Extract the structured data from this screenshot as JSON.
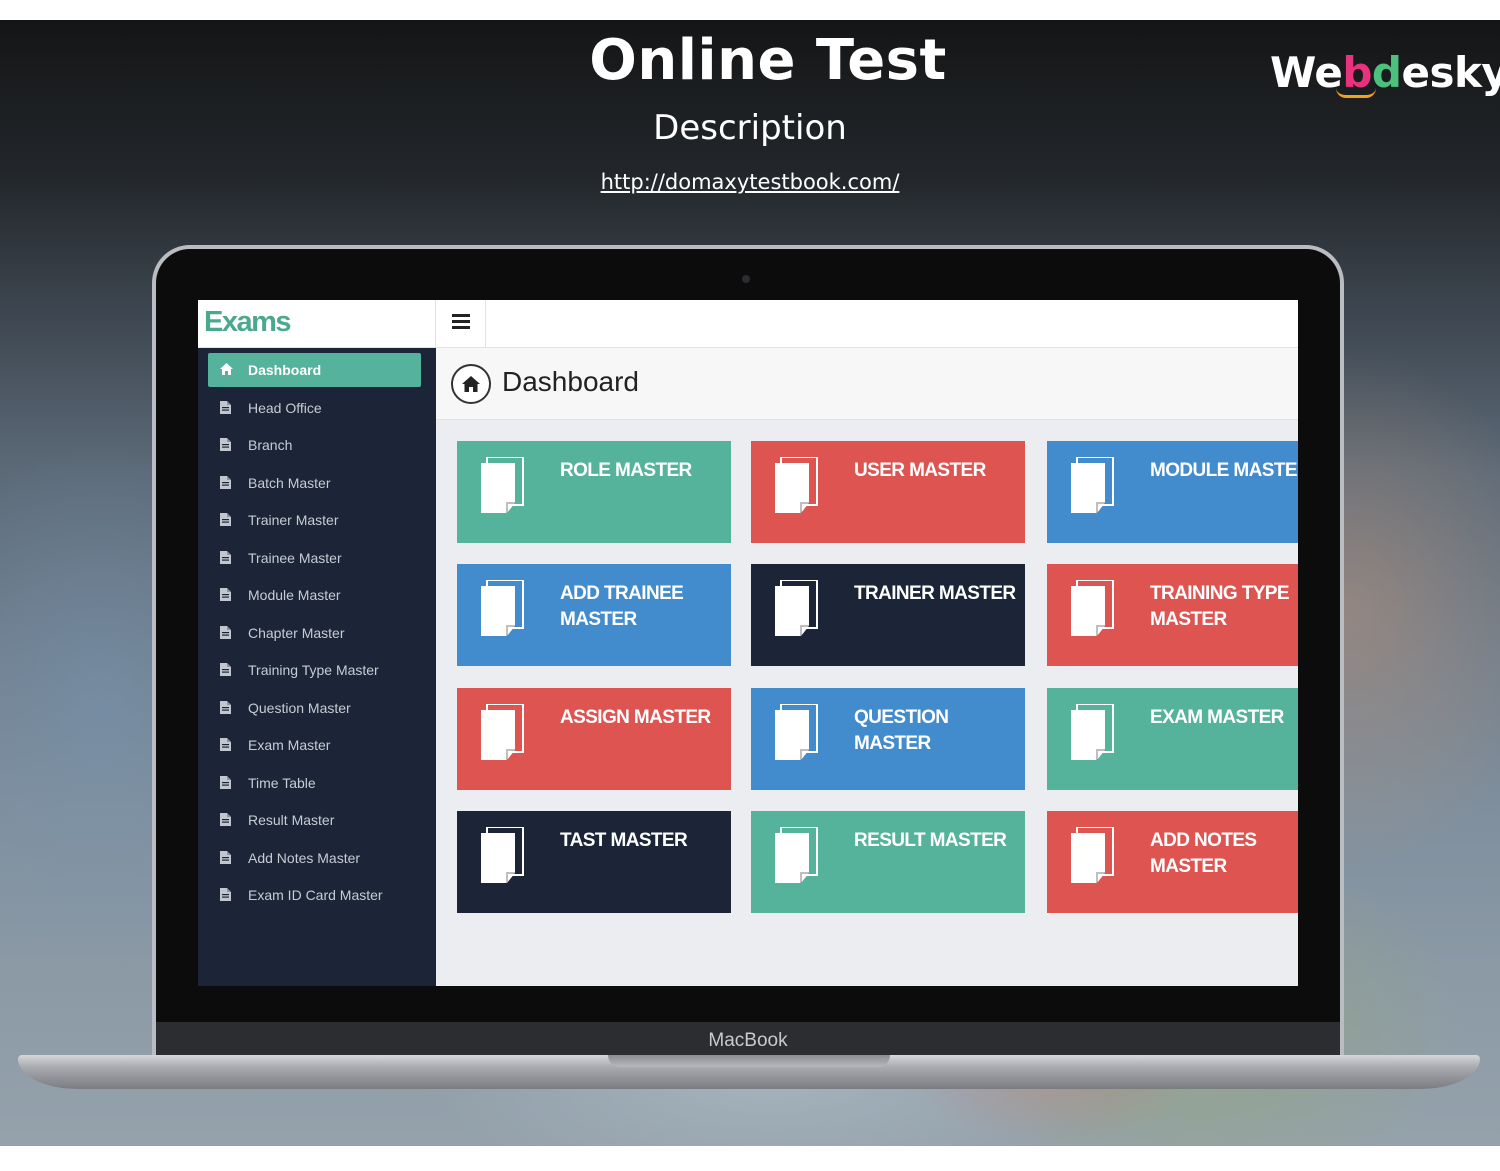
{
  "slide": {
    "title": "Online Test",
    "subtitle": "Description",
    "url": "http://domaxytestbook.com/",
    "brand": {
      "part1": "We",
      "part2": "b",
      "part3": "d",
      "part4": "esky"
    },
    "device_label": "MacBook"
  },
  "app": {
    "logo": "Exams",
    "page_title": "Dashboard",
    "sidebar": [
      {
        "label": "Dashboard",
        "icon": "home-icon",
        "active": true
      },
      {
        "label": "Head Office",
        "icon": "file-icon"
      },
      {
        "label": "Branch",
        "icon": "file-icon"
      },
      {
        "label": "Batch Master",
        "icon": "file-icon"
      },
      {
        "label": "Trainer Master",
        "icon": "file-icon"
      },
      {
        "label": "Trainee Master",
        "icon": "file-icon"
      },
      {
        "label": "Module Master",
        "icon": "file-icon"
      },
      {
        "label": "Chapter Master",
        "icon": "file-icon"
      },
      {
        "label": "Training Type Master",
        "icon": "file-icon"
      },
      {
        "label": "Question Master",
        "icon": "file-icon"
      },
      {
        "label": "Exam Master",
        "icon": "file-icon"
      },
      {
        "label": "Time Table",
        "icon": "file-icon"
      },
      {
        "label": "Result Master",
        "icon": "file-icon"
      },
      {
        "label": "Add Notes Master",
        "icon": "file-icon"
      },
      {
        "label": "Exam ID Card Master",
        "icon": "file-icon"
      }
    ],
    "tiles": [
      {
        "label": "ROLE MASTER",
        "color": "#56b39b"
      },
      {
        "label": "USER MASTER",
        "color": "#dd5451"
      },
      {
        "label": "MODULE MASTER",
        "color": "#428bcd"
      },
      {
        "label": "ADD TRAINEE\nMASTER",
        "color": "#428bcd"
      },
      {
        "label": "TRAINER MASTER",
        "color": "#1b2537"
      },
      {
        "label": "TRAINING TYPE\nMASTER",
        "color": "#dd5451"
      },
      {
        "label": "ASSIGN MASTER",
        "color": "#dd5451"
      },
      {
        "label": "QUESTION\nMASTER",
        "color": "#428bcd"
      },
      {
        "label": "EXAM MASTER",
        "color": "#56b39b"
      },
      {
        "label": "TAST MASTER",
        "color": "#1b2537"
      },
      {
        "label": "RESULT MASTER",
        "color": "#56b39b"
      },
      {
        "label": "ADD NOTES\nMASTER",
        "color": "#dd5451"
      }
    ]
  }
}
